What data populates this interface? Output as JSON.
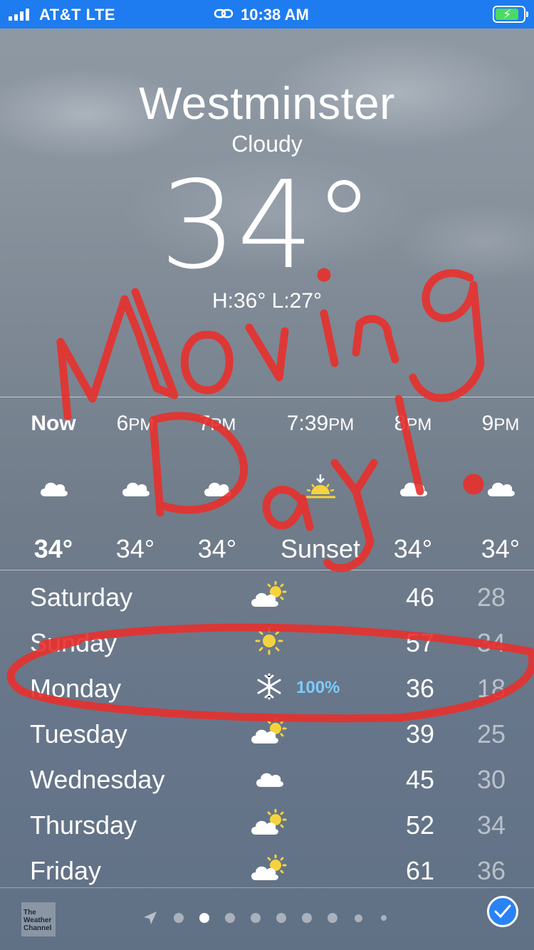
{
  "status_bar": {
    "carrier": "AT&T   LTE",
    "time": "10:38 AM"
  },
  "location": {
    "city": "Westminster",
    "condition": "Cloudy",
    "temperature": "34°",
    "hi_lo": "H:36°  L:27°"
  },
  "hourly": [
    {
      "label": "Now",
      "suffix": "",
      "icon": "cloud-icon",
      "temp": "34°"
    },
    {
      "label": "6",
      "suffix": "PM",
      "icon": "cloud-icon",
      "temp": "34°"
    },
    {
      "label": "7",
      "suffix": "PM",
      "icon": "cloud-icon",
      "temp": "34°"
    },
    {
      "label": "7:39",
      "suffix": "PM",
      "icon": "sunset-icon",
      "temp": "Sunset"
    },
    {
      "label": "8",
      "suffix": "PM",
      "icon": "cloud-icon",
      "temp": "34°"
    },
    {
      "label": "9",
      "suffix": "PM",
      "icon": "cloud-icon",
      "temp": "34°"
    }
  ],
  "daily": [
    {
      "day": "Saturday",
      "icon": "partly-sunny-icon",
      "precip": "",
      "high": "46",
      "low": "28"
    },
    {
      "day": "Sunday",
      "icon": "sun-icon",
      "precip": "",
      "high": "57",
      "low": "34"
    },
    {
      "day": "Monday",
      "icon": "snowflake-icon",
      "precip": "100%",
      "high": "36",
      "low": "18"
    },
    {
      "day": "Tuesday",
      "icon": "partly-sunny-icon",
      "precip": "",
      "high": "39",
      "low": "25"
    },
    {
      "day": "Wednesday",
      "icon": "cloud-icon",
      "precip": "",
      "high": "45",
      "low": "30"
    },
    {
      "day": "Thursday",
      "icon": "partly-sunny-icon",
      "precip": "",
      "high": "52",
      "low": "34"
    },
    {
      "day": "Friday",
      "icon": "partly-sunny-icon",
      "precip": "",
      "high": "61",
      "low": "36"
    }
  ],
  "footer": {
    "logo_text": "The Weather Channel",
    "page_count": 9,
    "active_page": 1,
    "icons": [
      "location-arrow-icon",
      "list-icon"
    ]
  },
  "annotation": {
    "text": "Moving Day!",
    "color": "#e8302c"
  },
  "colors": {
    "status_bar": "#1e7cf0",
    "precip": "#7ecbff",
    "sun": "#f6d33c"
  }
}
